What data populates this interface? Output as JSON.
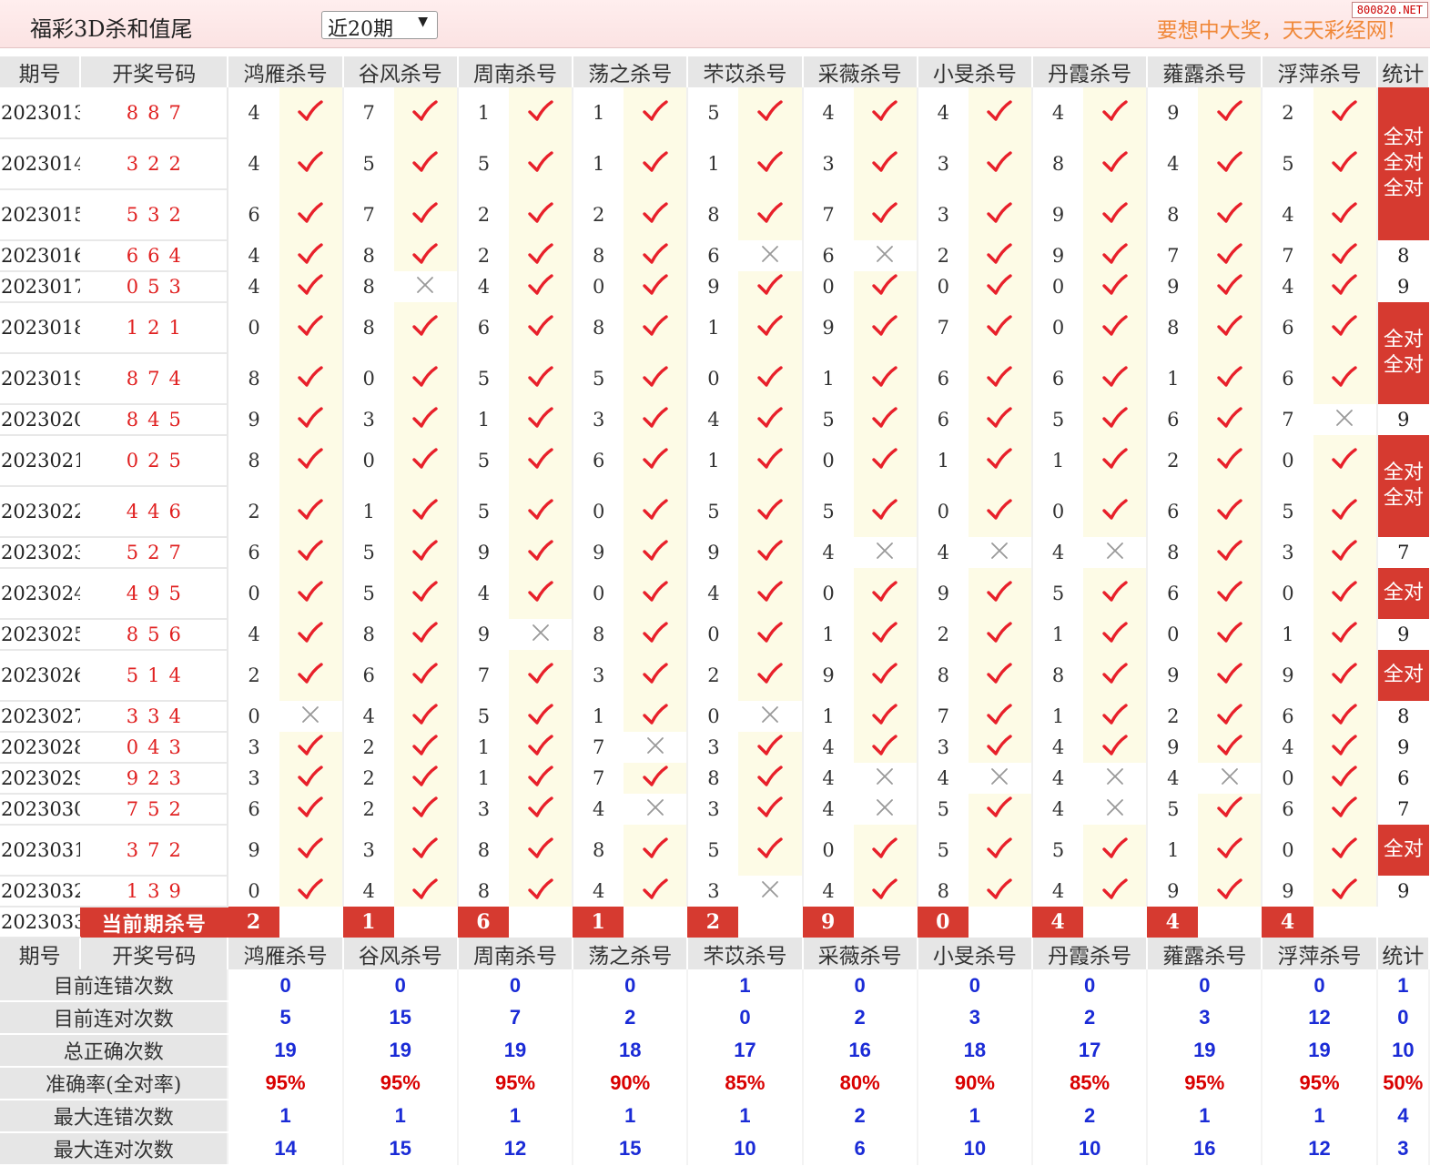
{
  "header": {
    "title": "福彩3D杀和值尾",
    "select_value": "近20期",
    "slogan": "要想中大奖，天天彩经网!",
    "watermark": "800820.NET"
  },
  "columns": {
    "period": "期号",
    "draw": "开奖号码",
    "experts": [
      "鸿雁杀号",
      "谷风杀号",
      "周南杀号",
      "荡之杀号",
      "芣苡杀号",
      "采薇杀号",
      "小旻杀号",
      "丹霞杀号",
      "蕹露杀号",
      "浮萍杀号"
    ],
    "stat": "统计"
  },
  "rows": [
    {
      "period": "2023013",
      "draw": "887",
      "kills": [
        4,
        7,
        1,
        1,
        5,
        4,
        4,
        4,
        9,
        2
      ],
      "ok": [
        1,
        1,
        1,
        1,
        1,
        1,
        1,
        1,
        1,
        1
      ],
      "stat": "全对",
      "span": 1
    },
    {
      "period": "2023014",
      "draw": "322",
      "kills": [
        4,
        5,
        5,
        1,
        1,
        3,
        3,
        8,
        4,
        5
      ],
      "ok": [
        1,
        1,
        1,
        1,
        1,
        1,
        1,
        1,
        1,
        1
      ],
      "stat": "全对",
      "span": 1
    },
    {
      "period": "2023015",
      "draw": "532",
      "kills": [
        6,
        7,
        2,
        2,
        8,
        7,
        3,
        9,
        8,
        4
      ],
      "ok": [
        1,
        1,
        1,
        1,
        1,
        1,
        1,
        1,
        1,
        1
      ],
      "stat": "全对",
      "span": 1
    },
    {
      "period": "2023016",
      "draw": "664",
      "kills": [
        4,
        8,
        2,
        8,
        6,
        6,
        2,
        9,
        7,
        7
      ],
      "ok": [
        1,
        1,
        1,
        1,
        0,
        0,
        1,
        1,
        1,
        1
      ],
      "stat": "8",
      "span": 0
    },
    {
      "period": "2023017",
      "draw": "053",
      "kills": [
        4,
        8,
        4,
        0,
        9,
        0,
        0,
        0,
        9,
        4
      ],
      "ok": [
        1,
        0,
        1,
        1,
        1,
        1,
        1,
        1,
        1,
        1
      ],
      "stat": "9",
      "span": 0
    },
    {
      "period": "2023018",
      "draw": "121",
      "kills": [
        0,
        8,
        6,
        8,
        1,
        9,
        7,
        0,
        8,
        6
      ],
      "ok": [
        1,
        1,
        1,
        1,
        1,
        1,
        1,
        1,
        1,
        1
      ],
      "stat": "全对",
      "span": 1
    },
    {
      "period": "2023019",
      "draw": "874",
      "kills": [
        8,
        0,
        5,
        5,
        0,
        1,
        6,
        6,
        1,
        6
      ],
      "ok": [
        1,
        1,
        1,
        1,
        1,
        1,
        1,
        1,
        1,
        1
      ],
      "stat": "全对",
      "span": 1
    },
    {
      "period": "2023020",
      "draw": "845",
      "kills": [
        9,
        3,
        1,
        3,
        4,
        5,
        6,
        5,
        6,
        7
      ],
      "ok": [
        1,
        1,
        1,
        1,
        1,
        1,
        1,
        1,
        1,
        0
      ],
      "stat": "9",
      "span": 0
    },
    {
      "period": "2023021",
      "draw": "025",
      "kills": [
        8,
        0,
        5,
        6,
        1,
        0,
        1,
        1,
        2,
        0
      ],
      "ok": [
        1,
        1,
        1,
        1,
        1,
        1,
        1,
        1,
        1,
        1
      ],
      "stat": "全对",
      "span": 1
    },
    {
      "period": "2023022",
      "draw": "446",
      "kills": [
        2,
        1,
        5,
        0,
        5,
        5,
        0,
        0,
        6,
        5
      ],
      "ok": [
        1,
        1,
        1,
        1,
        1,
        1,
        1,
        1,
        1,
        1
      ],
      "stat": "全对",
      "span": 1
    },
    {
      "period": "2023023",
      "draw": "527",
      "kills": [
        6,
        5,
        9,
        9,
        9,
        4,
        4,
        4,
        8,
        3
      ],
      "ok": [
        1,
        1,
        1,
        1,
        1,
        0,
        0,
        0,
        1,
        1
      ],
      "stat": "7",
      "span": 0
    },
    {
      "period": "2023024",
      "draw": "495",
      "kills": [
        0,
        5,
        4,
        0,
        4,
        0,
        9,
        5,
        6,
        0
      ],
      "ok": [
        1,
        1,
        1,
        1,
        1,
        1,
        1,
        1,
        1,
        1
      ],
      "stat": "全对",
      "span": 1
    },
    {
      "period": "2023025",
      "draw": "856",
      "kills": [
        4,
        8,
        9,
        8,
        0,
        1,
        2,
        1,
        0,
        1
      ],
      "ok": [
        1,
        1,
        0,
        1,
        1,
        1,
        1,
        1,
        1,
        1
      ],
      "stat": "9",
      "span": 0
    },
    {
      "period": "2023026",
      "draw": "514",
      "kills": [
        2,
        6,
        7,
        3,
        2,
        9,
        8,
        8,
        9,
        9
      ],
      "ok": [
        1,
        1,
        1,
        1,
        1,
        1,
        1,
        1,
        1,
        1
      ],
      "stat": "全对",
      "span": 1
    },
    {
      "period": "2023027",
      "draw": "334",
      "kills": [
        0,
        4,
        5,
        1,
        0,
        1,
        7,
        1,
        2,
        6
      ],
      "ok": [
        0,
        1,
        1,
        1,
        0,
        1,
        1,
        1,
        1,
        1
      ],
      "stat": "8",
      "span": 0
    },
    {
      "period": "2023028",
      "draw": "043",
      "kills": [
        3,
        2,
        1,
        7,
        3,
        4,
        3,
        4,
        9,
        4
      ],
      "ok": [
        1,
        1,
        1,
        0,
        1,
        1,
        1,
        1,
        1,
        1
      ],
      "stat": "9",
      "span": 0
    },
    {
      "period": "2023029",
      "draw": "923",
      "kills": [
        3,
        2,
        1,
        7,
        8,
        4,
        4,
        4,
        4,
        0
      ],
      "ok": [
        1,
        1,
        1,
        1,
        1,
        0,
        0,
        0,
        0,
        1
      ],
      "stat": "6",
      "span": 0
    },
    {
      "period": "2023030",
      "draw": "752",
      "kills": [
        6,
        2,
        3,
        4,
        3,
        4,
        5,
        4,
        5,
        6
      ],
      "ok": [
        1,
        1,
        1,
        0,
        1,
        0,
        1,
        0,
        1,
        1
      ],
      "stat": "7",
      "span": 0
    },
    {
      "period": "2023031",
      "draw": "372",
      "kills": [
        9,
        3,
        8,
        8,
        5,
        0,
        5,
        5,
        1,
        0
      ],
      "ok": [
        1,
        1,
        1,
        1,
        1,
        1,
        1,
        1,
        1,
        1
      ],
      "stat": "全对",
      "span": 1
    },
    {
      "period": "2023032",
      "draw": "139",
      "kills": [
        0,
        4,
        8,
        4,
        3,
        4,
        8,
        4,
        9,
        9
      ],
      "ok": [
        1,
        1,
        1,
        1,
        0,
        1,
        1,
        1,
        1,
        1
      ],
      "stat": "9",
      "span": 0
    }
  ],
  "current": {
    "period": "2023033",
    "label": "当前期杀号",
    "kills": [
      "2",
      "1",
      "6",
      "1",
      "2",
      "9",
      "0",
      "4",
      "4",
      "4"
    ]
  },
  "summary": [
    {
      "label": "目前连错次数",
      "values": [
        "0",
        "0",
        "0",
        "0",
        "1",
        "0",
        "0",
        "0",
        "0",
        "0",
        "1"
      ],
      "color": "blue"
    },
    {
      "label": "目前连对次数",
      "values": [
        "5",
        "15",
        "7",
        "2",
        "0",
        "2",
        "3",
        "2",
        "3",
        "12",
        "0"
      ],
      "color": "blue"
    },
    {
      "label": "总正确次数",
      "values": [
        "19",
        "19",
        "19",
        "18",
        "17",
        "16",
        "18",
        "17",
        "19",
        "19",
        "10"
      ],
      "color": "blue"
    },
    {
      "label": "准确率(全对率)",
      "values": [
        "95%",
        "95%",
        "95%",
        "90%",
        "85%",
        "80%",
        "90%",
        "85%",
        "95%",
        "95%",
        "50%"
      ],
      "color": "red"
    },
    {
      "label": "最大连错次数",
      "values": [
        "1",
        "1",
        "1",
        "1",
        "1",
        "2",
        "1",
        "2",
        "1",
        "1",
        "4"
      ],
      "color": "blue"
    },
    {
      "label": "最大连对次数",
      "values": [
        "14",
        "15",
        "12",
        "15",
        "10",
        "6",
        "10",
        "10",
        "16",
        "12",
        "3"
      ],
      "color": "blue"
    }
  ],
  "colors": {
    "check": "#e8202a",
    "cross": "#999999",
    "accent": "#d63a30"
  }
}
